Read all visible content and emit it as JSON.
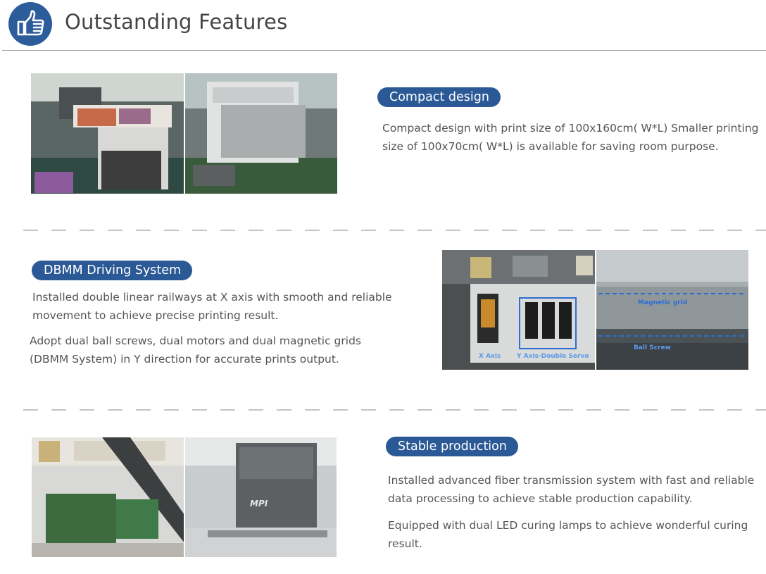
{
  "header": {
    "title": "Outstanding Features",
    "icon": "thumbs-up-icon"
  },
  "colors": {
    "accent": "#2b5996",
    "text": "#555555",
    "divider": "#c4c4c4"
  },
  "sections": [
    {
      "title": "Compact design",
      "paragraphs": [
        "Compact design with print size of 100x160cm( W*L)  Smaller printing size of 100x70cm( W*L) is available for  saving room purpose."
      ]
    },
    {
      "title": "DBMM Driving System",
      "paragraphs": [
        "Installed double linear railways at X axis with smooth and reliable movement to achieve precise printing result.",
        "Adopt dual ball screws, dual motors and dual magnetic grids (DBMM System) in Y direction for accurate prints output."
      ],
      "photo_labels": {
        "x_axis": "X Axis",
        "y_axis": "Y Axis-Double Servo",
        "magnetic_grid": "Magnetic grid",
        "ball_screw": "Ball Screw"
      }
    },
    {
      "title": "Stable production",
      "paragraphs": [
        "Installed advanced fiber transmission system with fast and reliable data processing to achieve stable production capability.",
        "Equipped with dual LED curing lamps to achieve wonderful curing result."
      ],
      "photo_labels": {
        "printer_logo": "MPI"
      }
    }
  ]
}
